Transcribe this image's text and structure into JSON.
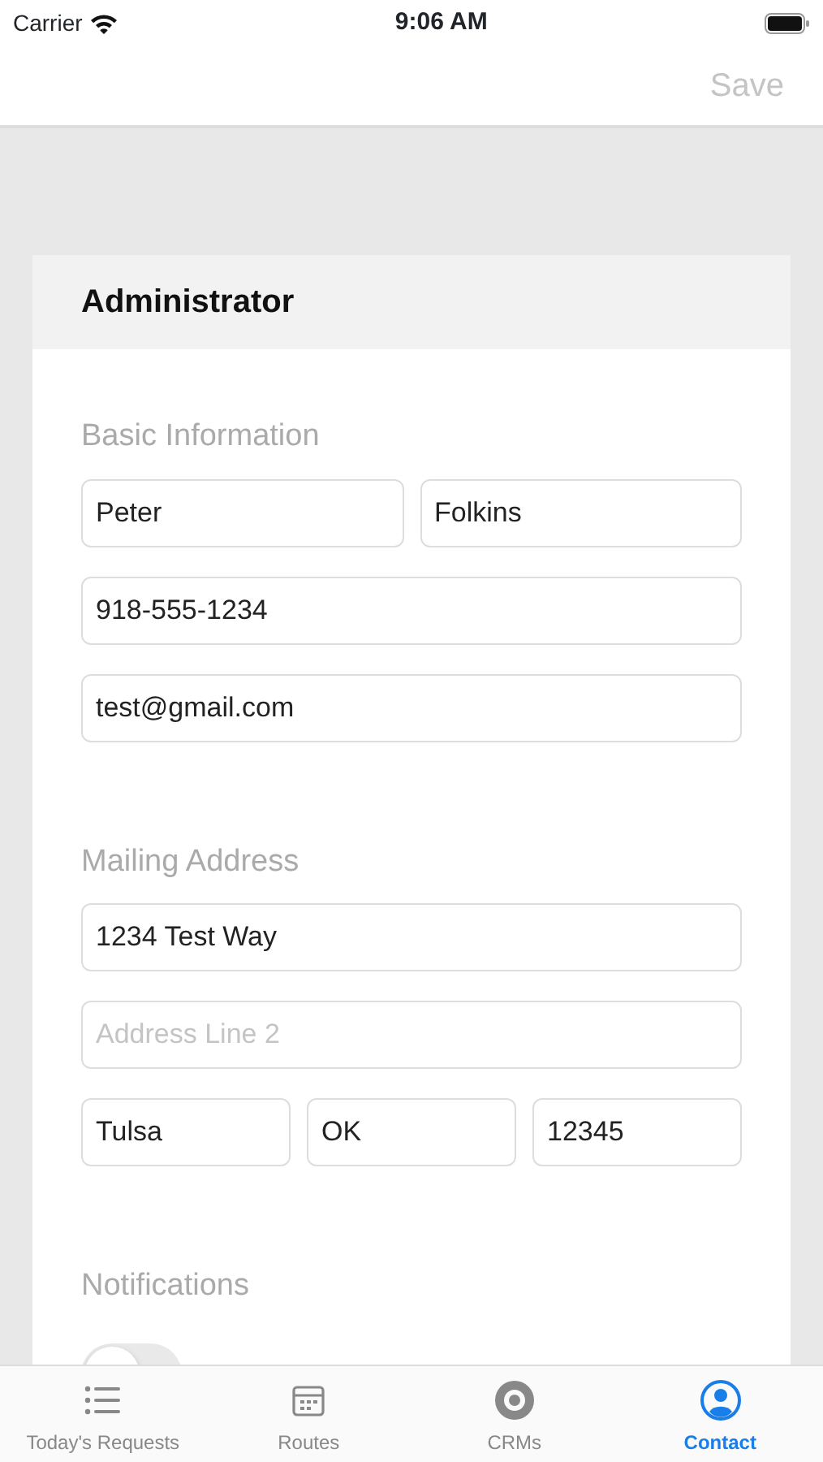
{
  "status_bar": {
    "carrier": "Carrier",
    "time": "9:06 AM"
  },
  "nav_bar": {
    "save": "Save",
    "save_disabled": true
  },
  "card": {
    "title": "Administrator",
    "sections": [
      {
        "title": "Basic Information",
        "rows": [
          [
            {
              "value": "Peter"
            },
            {
              "value": "Folkins"
            }
          ],
          [
            {
              "value": "918-555-1234"
            }
          ],
          [
            {
              "value": "test@gmail.com"
            }
          ]
        ]
      },
      {
        "title": "Mailing Address",
        "rows": [
          [
            {
              "value": "1234 Test Way"
            }
          ],
          [
            {
              "placeholder": "Address Line 2"
            }
          ],
          [
            {
              "value": "Tulsa"
            },
            {
              "value": "OK"
            },
            {
              "value": "12345"
            }
          ]
        ]
      },
      {
        "title": "Notifications",
        "toggle": {
          "on": false
        }
      }
    ]
  },
  "tabs": [
    {
      "label": "Today's Requests",
      "kind": "list",
      "selected": false
    },
    {
      "label": "Routes",
      "kind": "calendar",
      "selected": false
    },
    {
      "label": "CRMs",
      "kind": "target",
      "selected": false
    },
    {
      "label": "Contact",
      "kind": "person",
      "selected": true
    }
  ]
}
